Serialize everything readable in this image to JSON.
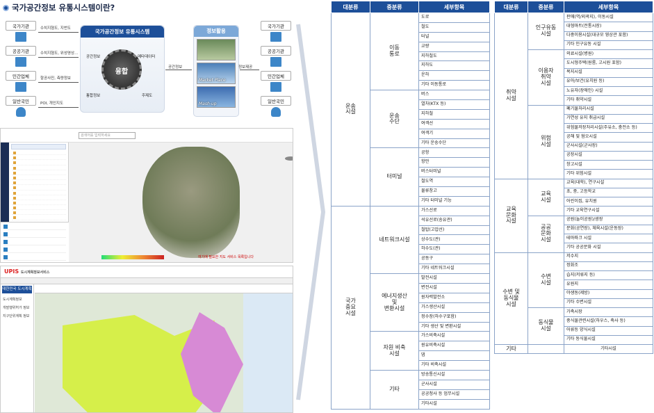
{
  "title": "국가공간정보 유통시스템이란?",
  "diagram": {
    "left_entities": [
      "국가기관",
      "공공기관",
      "민간업체",
      "일반국민"
    ],
    "right_entities": [
      "국가기관",
      "공공기관",
      "민간업체",
      "일반국민"
    ],
    "left_arrows": [
      "수치지형도, 지번도",
      "수치지형도, 위성영상...",
      "항공사진, 측량정보",
      "POI, 개인지도"
    ],
    "system_title": "국가공간정보 유통시스템",
    "center_label": "융합",
    "system_labels": [
      "공간정보",
      "메타데이터",
      "통합정보",
      "주제도"
    ],
    "arrow_to_use": "공간정보",
    "info_title": "정보활용",
    "info_items": [
      "",
      "Market Place",
      "Mash-up"
    ],
    "info_out": "정보제공"
  },
  "screen1": {
    "search_placeholder": "검색어를 입력하세요",
    "map_caption": "여기에 필요한 지도 서비스 목록입니다"
  },
  "screen2": {
    "logo_main": "UPIS",
    "logo_sub": "도시계획정보서비스",
    "left_header": "대한민국 도시계획",
    "left_items": [
      "도시계획정보",
      "개발행위허가 정보",
      "지구단위계획 정보"
    ]
  },
  "table1": {
    "headers": [
      "대분류",
      "중분류",
      "세부항목"
    ],
    "groups": [
      {
        "major": "운송\n시설",
        "mids": [
          {
            "name": "이동\n통로",
            "items": [
              "도로",
              "철도",
              "터널",
              "교량",
              "지하철도",
              "지하도",
              "운하",
              "기타 이동통로"
            ]
          },
          {
            "name": "운송\n수단",
            "items": [
              "버스",
              "열차(KTX 등)",
              "지하철",
              "여객선",
              "여객기",
              "기타 운송수단"
            ]
          },
          {
            "name": "터미널",
            "items": [
              "공항",
              "항만",
              "버스터미널",
              "철도역",
              "물류창고",
              "기타 터미널 기능"
            ]
          }
        ]
      },
      {
        "major": "국가\n중요\n시설",
        "mids": [
          {
            "name": "네트워크시설",
            "items": [
              "가스선로",
              "석유선로(송유관)",
              "철탑(고압선)",
              "상수도(관)",
              "하수도(관)",
              "공동구",
              "기타 네트워크시설"
            ]
          },
          {
            "name": "에너지생산\n및\n변환시설",
            "items": [
              "발전시설",
              "변전시설",
              "원자력발전소",
              "가스생산시설",
              "정수장(하수구포함)",
              "기타 생산 및 변환시설"
            ]
          },
          {
            "name": "자원 비축\n시설",
            "items": [
              "가스비축시설",
              "원유비축시설",
              "댐",
              "기타 비축시설"
            ]
          },
          {
            "name": "기타",
            "items": [
              "방송통신시설",
              "군사시설",
              "공공청사 등 업무시설",
              "기타시설"
            ]
          }
        ]
      }
    ]
  },
  "table2": {
    "headers": [
      "대분류",
      "중분류",
      "세부항목"
    ],
    "groups": [
      {
        "major": "취약\n시설",
        "mids": [
          {
            "name": "인구유동\n시설",
            "items": [
              "판매(역/외곽지), 이동시설",
              "대형마트(전통시장)",
              "다중이용시설(대규모 영상관 포함)",
              "기타 인구유동 시설"
            ]
          },
          {
            "name": "이용자\n취약\n시설",
            "items": [
              "의료시설(병원)",
              "도시형주택(원룸, 고시원 포함)",
              "복지시설",
              "유아/보건(유치원 등)",
              "노유자(장애인) 시설",
              "기타 취약시설"
            ]
          },
          {
            "name": "위험\n시설",
            "items": [
              "폐기물처리시설",
              "가연성 유지 취급시설",
              "위험물저장처리시설(주유소, 충전소 등)",
              "공해 및 혐오시설",
              "군사시설(군사장)",
              "공장시설",
              "창고시설",
              "기타 위험시설"
            ]
          }
        ]
      },
      {
        "major": "교육\n문화\n시설",
        "mids": [
          {
            "name": "교육\n시설",
            "items": [
              "교육(대학), 연구시설",
              "초, 중, 고등학교",
              "어린이집, 유치원",
              "기타 교육연구시설"
            ]
          },
          {
            "name": "공공\n문화\n시설",
            "items": [
              "공원(놀이공원)/광장",
              "문화(공연장), 체육시설(운동장)",
              "테마파크 시설",
              "기타 공공문화 시설"
            ]
          }
        ]
      },
      {
        "major": "수변 및\n동식물\n시설",
        "mids": [
          {
            "name": "수변\n시설",
            "items": [
              "저수지",
              "정화조",
              "습지(저류지 등)",
              "유원지",
              "야생동(제방)",
              "기타 수변시설"
            ]
          },
          {
            "name": "동식물\n시설",
            "items": [
              "가축시장",
              "중식물관련시설(하우스, 축사 등)",
              "어류등 양식시설",
              "기타 동식물시설"
            ]
          }
        ]
      },
      {
        "major": "기타",
        "mids": [
          {
            "name": "",
            "items": [
              "기타시설"
            ]
          }
        ]
      }
    ]
  },
  "colors": {
    "header_blue": "#1d4f99",
    "border": "#8aa3c8"
  }
}
